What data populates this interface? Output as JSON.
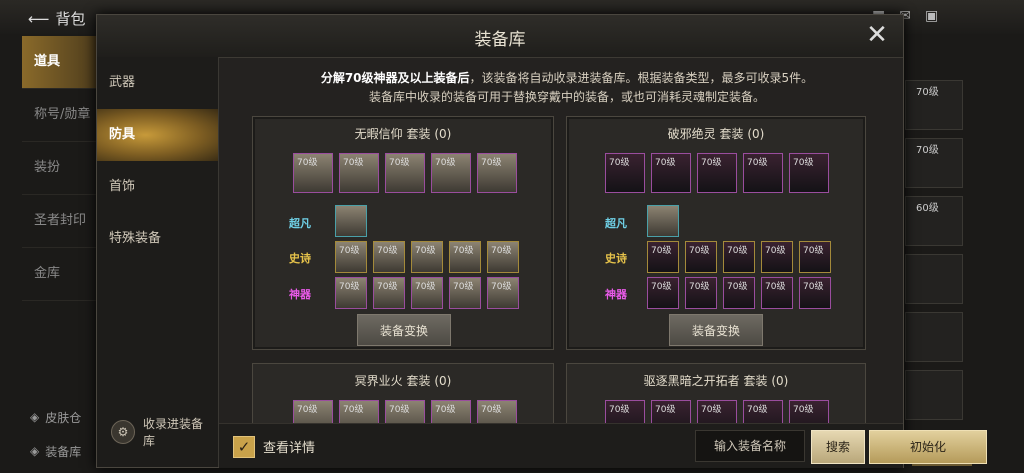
{
  "background": {
    "back_label": "背包",
    "sidebar": [
      "道具",
      "称号/勋章",
      "装扮",
      "圣者封印",
      "金库"
    ],
    "bottom_items": [
      "皮肤仓",
      "装备库"
    ],
    "right_slots": [
      "70级",
      "70级",
      "60级"
    ],
    "decompose_label": "分解"
  },
  "modal": {
    "title": "装备库",
    "close_icon": "close-icon",
    "nav": [
      "武器",
      "防具",
      "首饰",
      "特殊装备"
    ],
    "active_nav": "防具",
    "collect_label": "收录进装备库",
    "notice": {
      "line1_bold": "分解70级神器及以上装备后",
      "line1_rest": "，该装备将自动收录进装备库。根据装备类型，最多可收录5件。",
      "line2": "装备库中收录的装备可用于替换穿戴中的装备，或也可消耗灵魂制定装备。"
    },
    "sets": [
      {
        "name": "无暇信仰",
        "suffix": "套装",
        "count": "(0)",
        "top_slots": [
          "70级",
          "70级",
          "70级",
          "70级",
          "70级"
        ],
        "grades": {
          "chaofan": "超凡",
          "shishi": "史诗",
          "shenqi": "神器"
        },
        "epic_slots": [
          "70级",
          "70级",
          "70级",
          "70级",
          "70级"
        ],
        "myth_slots": [
          "70级",
          "70级",
          "70级",
          "70级",
          "70级"
        ],
        "swap_label": "装备变换"
      },
      {
        "name": "破邪绝灵",
        "suffix": "套装",
        "count": "(0)",
        "top_slots": [
          "70级",
          "70级",
          "70级",
          "70级",
          "70级"
        ],
        "grades": {
          "chaofan": "超凡",
          "shishi": "史诗",
          "shenqi": "神器"
        },
        "epic_slots": [
          "70级",
          "70级",
          "70级",
          "70级",
          "70级"
        ],
        "myth_slots": [
          "70级",
          "70级",
          "70级",
          "70级",
          "70级"
        ],
        "swap_label": "装备变换"
      },
      {
        "name": "冥界业火",
        "suffix": "套装",
        "count": "(0)",
        "top_slots": [
          "70级",
          "70级",
          "70级",
          "70级",
          "70级"
        ]
      },
      {
        "name": "驱逐黑暗之开拓者",
        "suffix": "套装",
        "count": "(0)",
        "top_slots": [
          "70级",
          "70级",
          "70级",
          "70级",
          "70级"
        ]
      }
    ],
    "footer": {
      "checkbox_checked": true,
      "checkbox_label": "查看详情",
      "search_placeholder": "输入装备名称",
      "search_button": "搜索",
      "init_button": "初始化"
    }
  }
}
